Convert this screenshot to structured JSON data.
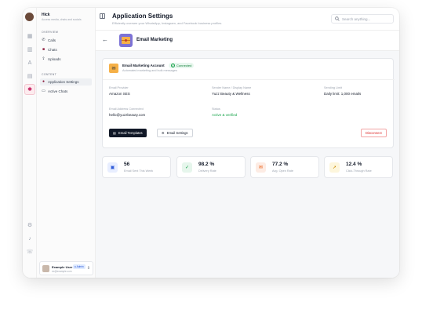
{
  "brand": {
    "name": "Hick",
    "subtitle": "Access media, chats and socials"
  },
  "sidebar": {
    "overview_label": "OVERVIEW",
    "overview_items": [
      {
        "label": "Calls",
        "icon": "phone-icon"
      },
      {
        "label": "Chats",
        "icon": "chat-icon"
      },
      {
        "label": "Uploads",
        "icon": "upload-icon"
      }
    ],
    "content_label": "CONTENT",
    "content_items": [
      {
        "label": "Application Settings",
        "icon": "settings-icon"
      },
      {
        "label": "Active Chats",
        "icon": "chat-icon"
      }
    ]
  },
  "user": {
    "name": "Example User",
    "role": "Admin",
    "email": "ex@example.com"
  },
  "header": {
    "title": "Application Settings",
    "subtitle": "Efficiently oversee your WhatsApp, Instagram, and Facebook business profiles",
    "search_placeholder": "Search anything..."
  },
  "subheader": {
    "title": "Email Marketing"
  },
  "account": {
    "title": "Email Marketing Account",
    "status": "Connected",
    "description": "Automated marketing and bulk messages",
    "fields": {
      "provider_label": "Email Provider",
      "provider_value": "Amazon SES",
      "sender_label": "Sender Name / Display Name",
      "sender_value": "Yuzz Beauty & Wellness",
      "limit_label": "Sending Limit",
      "limit_value": "Daily limit: 1,000 emails",
      "address_label": "Email Address Connected",
      "address_value": "hello@yuzzbeauty.com",
      "status_label": "Status",
      "status_value": "Active & verified"
    },
    "buttons": {
      "templates": "Email Templates",
      "settings": "Email Settings",
      "disconnect": "Disconnect"
    }
  },
  "stats": [
    {
      "value": "56",
      "label": "Email Sent This Week",
      "icon": "mail-icon",
      "color": "#2f5bd8",
      "bg": "#e8eeff"
    },
    {
      "value": "98.2 %",
      "label": "Delivery Rate",
      "icon": "check-icon",
      "color": "#16a34a",
      "bg": "#e6f6ec"
    },
    {
      "value": "77.2 %",
      "label": "Avg. Open Rate",
      "icon": "envelope-open-icon",
      "color": "#ea580c",
      "bg": "#fdece4"
    },
    {
      "value": "12.4 %",
      "label": "Click-Through Rate",
      "icon": "cursor-icon",
      "color": "#ca8a04",
      "bg": "#fdf6dc"
    }
  ],
  "colors": {
    "accent": "#c2185b",
    "primary_button": "#111827",
    "success": "#16a34a",
    "danger": "#dc2626"
  }
}
